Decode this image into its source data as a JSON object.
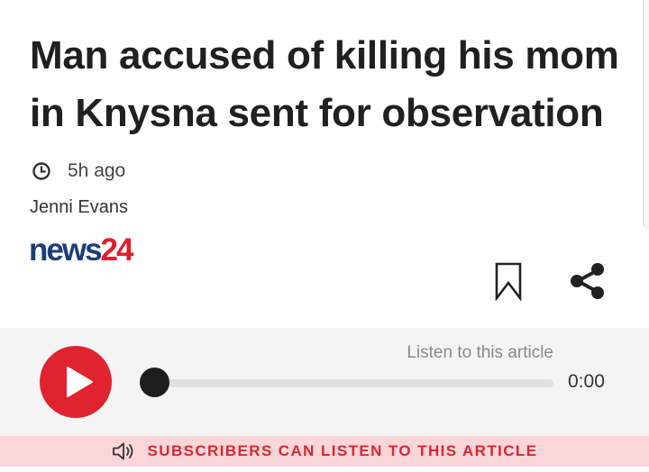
{
  "article": {
    "headline": "Man accused of killing his mom in Knysna sent for observation",
    "time_ago": "5h ago",
    "author": "Jenni Evans"
  },
  "source_logo": {
    "part1": "news",
    "part2": "24"
  },
  "actions": {
    "bookmark_icon": "bookmark-icon",
    "share_icon": "share-icon"
  },
  "audio_player": {
    "label": "Listen to this article",
    "duration": "0:00",
    "progress": 0,
    "play_icon": "play-icon"
  },
  "subscriber_banner": {
    "text": "SUBSCRIBERS CAN LISTEN TO THIS ARTICLE",
    "icon": "speaker-icon"
  },
  "colors": {
    "accent_red": "#e0242f",
    "logo_blue": "#1b3d7a",
    "banner_bg": "#f9d6d8",
    "banner_text": "#d92731"
  }
}
